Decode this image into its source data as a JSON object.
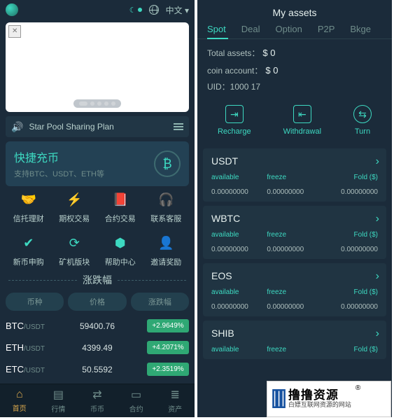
{
  "left": {
    "lang": "中文",
    "announce": "Star Pool Sharing Plan",
    "quick": {
      "title": "快捷充币",
      "sub": "支持BTC、USDT、ETH等"
    },
    "grid": [
      "信托理财",
      "期权交易",
      "合约交易",
      "联系客服",
      "新币申购",
      "矿机版块",
      "帮助中心",
      "邀请奖励"
    ],
    "section": "涨跌幅",
    "theaders": [
      "币种",
      "价格",
      "涨跌幅"
    ],
    "rows": [
      {
        "base": "BTC",
        "quote": "/USDT",
        "price": "59400.76",
        "pct": "+2.9649%"
      },
      {
        "base": "ETH",
        "quote": "/USDT",
        "price": "4399.49",
        "pct": "+4.2071%"
      },
      {
        "base": "ETC",
        "quote": "/USDT",
        "price": "50.5592",
        "pct": "+2.3519%"
      }
    ],
    "nav": [
      "首页",
      "行情",
      "币币",
      "合约",
      "资产"
    ]
  },
  "right": {
    "title": "My assets",
    "tabs": [
      "Spot",
      "Deal",
      "Option",
      "P2P",
      "Bkge"
    ],
    "summary": {
      "total_label": "Total assets：",
      "total_value": "$ 0",
      "coin_label": "coin account：",
      "coin_value": "$ 0",
      "uid_label": "UID：",
      "uid_value": "1000 17"
    },
    "actions": [
      "Recharge",
      "Withdrawal",
      "Turn"
    ],
    "cols": [
      "available",
      "freeze",
      "Fold ($)"
    ],
    "zero": "0.00000000",
    "assets": [
      "USDT",
      "WBTC",
      "EOS",
      "SHIB"
    ]
  },
  "watermark": {
    "main": "撸撸资源",
    "sub": "白嫖互联网资源的网站",
    "r": "®"
  }
}
